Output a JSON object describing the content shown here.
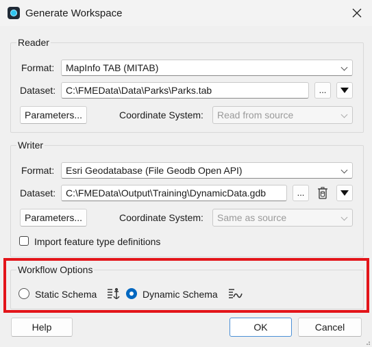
{
  "window": {
    "title": "Generate Workspace"
  },
  "reader": {
    "group_label": "Reader",
    "format_label": "Format:",
    "format_value": "MapInfo TAB (MITAB)",
    "dataset_label": "Dataset:",
    "dataset_value": "C:\\FMEData\\Data\\Parks\\Parks.tab",
    "browse_label": "...",
    "parameters_label": "Parameters...",
    "coord_label": "Coordinate System:",
    "coord_value": "Read from source"
  },
  "writer": {
    "group_label": "Writer",
    "format_label": "Format:",
    "format_value": "Esri Geodatabase (File Geodb Open API)",
    "dataset_label": "Dataset:",
    "dataset_value": "C:\\FMEData\\Output\\Training\\DynamicData.gdb",
    "browse_label": "...",
    "parameters_label": "Parameters...",
    "coord_label": "Coordinate System:",
    "coord_value": "Same as source",
    "import_label": "Import feature type definitions",
    "import_checked": false
  },
  "workflow": {
    "group_label": "Workflow Options",
    "static_label": "Static Schema",
    "dynamic_label": "Dynamic Schema",
    "selected": "dynamic"
  },
  "buttons": {
    "help": "Help",
    "ok": "OK",
    "cancel": "Cancel"
  },
  "colors": {
    "highlight": "#e3151a",
    "accent": "#0067c0"
  }
}
